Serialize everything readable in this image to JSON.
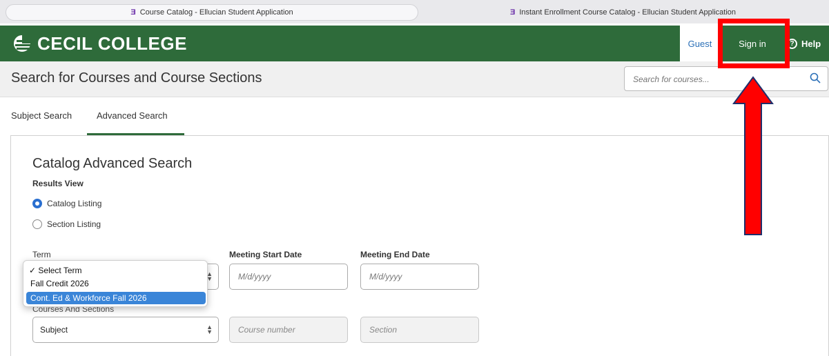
{
  "browser": {
    "tabs": [
      {
        "favicon": "Ǝ",
        "title": "Course Catalog - Ellucian Student Application"
      },
      {
        "favicon": "Ǝ",
        "title": "Instant Enrollment Course Catalog - Ellucian Student Application"
      }
    ]
  },
  "header": {
    "logo_text": "CECIL COLLEGE",
    "guest_label": "Guest",
    "signin_label": "Sign in",
    "help_label": "Help",
    "brand_color": "#2e6b3a"
  },
  "titlebar": {
    "title": "Search for Courses and Course Sections",
    "search_placeholder": "Search for courses..."
  },
  "subtabs": [
    "Subject Search",
    "Advanced Search"
  ],
  "form": {
    "title": "Catalog Advanced Search",
    "results_view_label": "Results View",
    "radio_options": [
      "Catalog Listing",
      "Section Listing"
    ],
    "term_label": "Term",
    "meeting_start_label": "Meeting Start Date",
    "meeting_end_label": "Meeting End Date",
    "date_placeholder": "M/d/yyyy",
    "courses_sections_label": "Courses And Sections",
    "subject_select_value": "Subject",
    "course_number_placeholder": "Course number",
    "section_placeholder": "Section"
  },
  "term_dropdown": {
    "options": [
      "✓ Select Term",
      "Fall Credit 2026",
      "Cont. Ed & Workforce Fall 2026"
    ],
    "highlighted_index": 2
  },
  "annotation": {
    "color": "#ff0000",
    "icon": "up-arrow-icon"
  }
}
